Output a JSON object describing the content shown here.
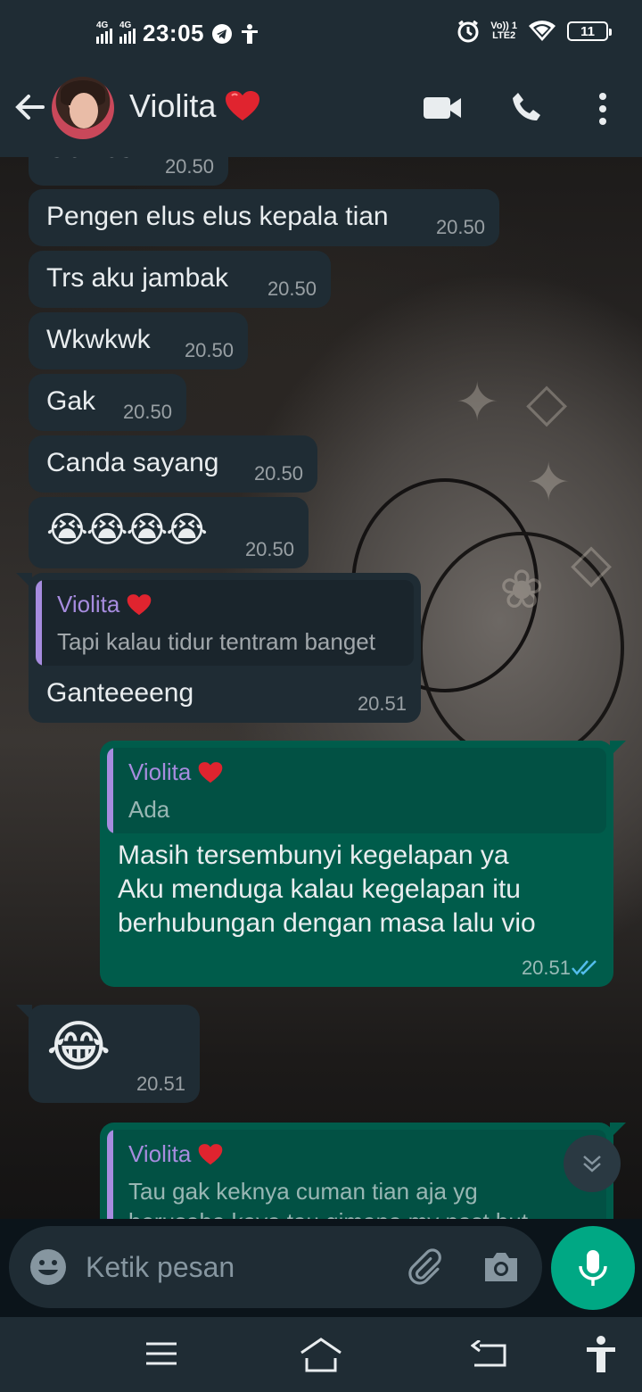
{
  "status_bar": {
    "time": "23:05",
    "sim1": "4G",
    "sim2": "4G",
    "volte_top": "Vo)) 1",
    "volte_bottom": "LTE2",
    "battery": "11"
  },
  "header": {
    "contact_name": "Violita",
    "icons": [
      "back-arrow-icon",
      "video-call-icon",
      "voice-call-icon",
      "more-options-icon"
    ]
  },
  "messages": [
    {
      "dir": "in",
      "text": "Gemes",
      "time": "20.50"
    },
    {
      "dir": "in",
      "text": "Pengen elus elus kepala tian",
      "time": "20.50"
    },
    {
      "dir": "in",
      "text": "Trs aku jambak",
      "time": "20.50"
    },
    {
      "dir": "in",
      "text": "Wkwkwk",
      "time": "20.50"
    },
    {
      "dir": "in",
      "text": "Gak",
      "time": "20.50"
    },
    {
      "dir": "in",
      "text": "Canda sayang",
      "time": "20.50"
    },
    {
      "dir": "in",
      "text": "😭😭😭😭",
      "time": "20.50"
    },
    {
      "dir": "in",
      "quote_name": "Violita",
      "quote_text": "Tapi kalau tidur tentram banget",
      "text": "Ganteeeeng",
      "time": "20.51"
    },
    {
      "dir": "out",
      "quote_name": "Violita",
      "quote_text": "Ada",
      "lines": [
        "Masih tersembunyi kegelapan ya",
        "Aku menduga kalau kegelapan itu",
        "berhubungan dengan masa lalu vio"
      ],
      "time": "20.51",
      "status": "read"
    },
    {
      "dir": "in",
      "text": "😂",
      "time": "20.51"
    },
    {
      "dir": "out",
      "quote_name": "Violita",
      "quote_lines": [
        "Tau gak keknya cuman tian aja yg",
        "berusaha kaya tau gimana my past but"
      ]
    }
  ],
  "input": {
    "placeholder": "Ketik pesan"
  },
  "colors": {
    "incoming_bubble": "#1f2c34",
    "outgoing_bubble": "#005c4b",
    "accent": "#00a884",
    "quote_name": "#a78cdf",
    "read_ticks": "#53bdeb"
  }
}
